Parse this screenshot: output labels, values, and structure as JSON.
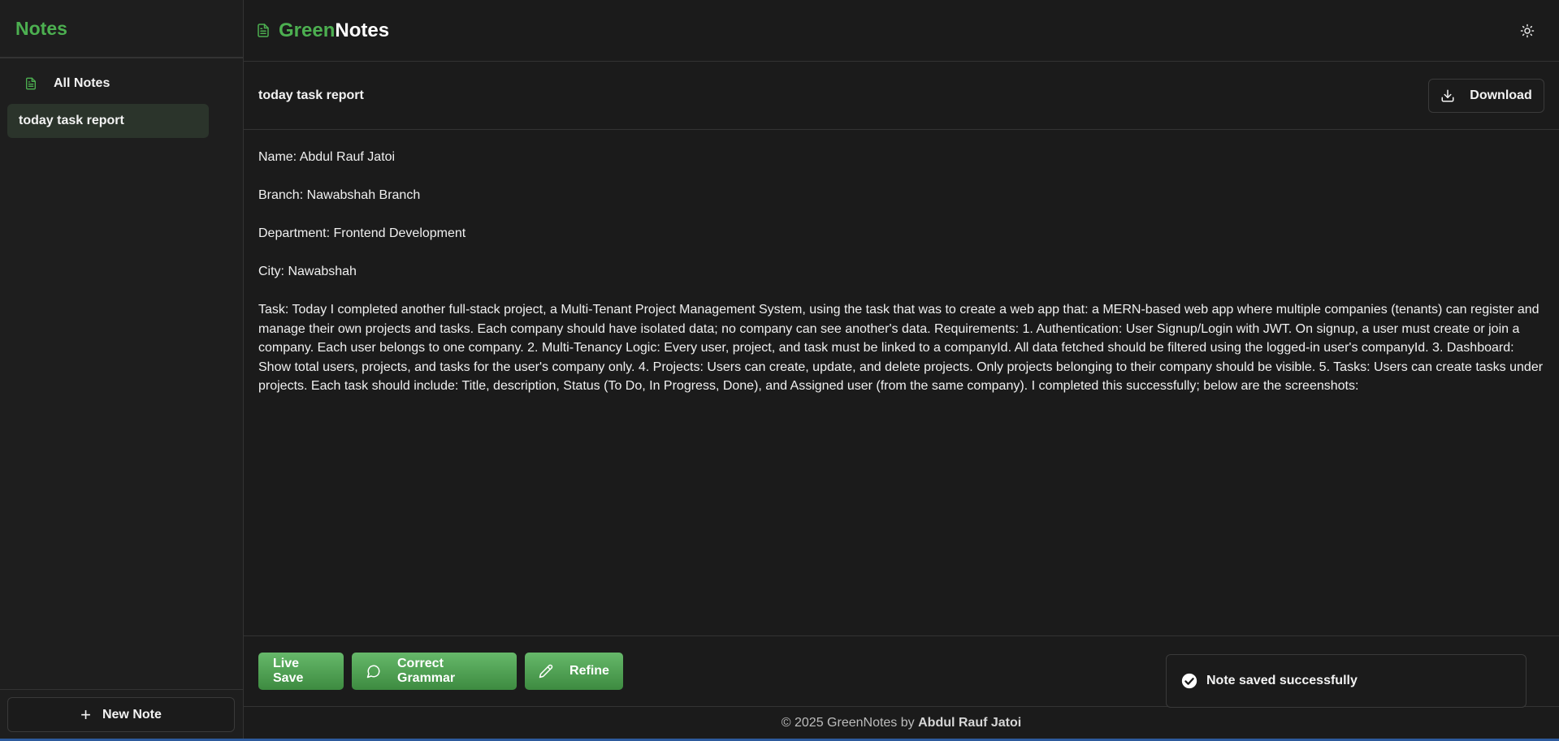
{
  "sidebar": {
    "title": "Notes",
    "all_notes_label": "All Notes",
    "notes": [
      {
        "title": "today task report"
      }
    ],
    "new_note_label": "New Note"
  },
  "topbar": {
    "brand_green": "Green",
    "brand_white": "Notes"
  },
  "note": {
    "title": "today task report",
    "download_label": "Download",
    "body": [
      "Name: Abdul Rauf Jatoi",
      "Branch: Nawabshah Branch",
      "Department: Frontend Development",
      "City: Nawabshah",
      "Task: Today I completed another full-stack project, a Multi-Tenant Project Management System, using the task that was to create a web app that: a MERN-based web app where multiple companies (tenants) can register and manage their own projects and tasks. Each company should have isolated data; no company can see another's data. Requirements: 1. Authentication: User Signup/Login with JWT. On signup, a user must create or join a company. Each user belongs to one company. 2. Multi-Tenancy Logic: Every user, project, and task must be linked to a companyId. All data fetched should be filtered using the logged-in user's companyId. 3. Dashboard: Show total users, projects, and tasks for the user's company only. 4. Projects: Users can create, update, and delete projects. Only projects belonging to their company should be visible. 5. Tasks: Users can create tasks under projects. Each task should include: Title, description, Status (To Do, In Progress, Done), and Assigned user (from the same company). I completed this successfully; below are the screenshots:"
    ]
  },
  "actions": {
    "live_save": "Live Save",
    "correct_grammar": "Correct Grammar",
    "refine": "Refine"
  },
  "toast": {
    "message": "Note saved successfully"
  },
  "footer": {
    "prefix": "© 2025 GreenNotes by ",
    "author": "Abdul Rauf Jatoi"
  },
  "colors": {
    "accent": "#4caf50",
    "background": "#1b1b1b",
    "selected_note_bg": "#2b342b"
  },
  "icons": {
    "nav_all_notes": "document-icon",
    "brand": "document-icon",
    "theme": "sun-icon",
    "download": "download-icon",
    "grammar": "message-circle-icon",
    "refine": "pencil-icon",
    "toast": "check-circle-icon",
    "new_note": "plus-icon"
  }
}
